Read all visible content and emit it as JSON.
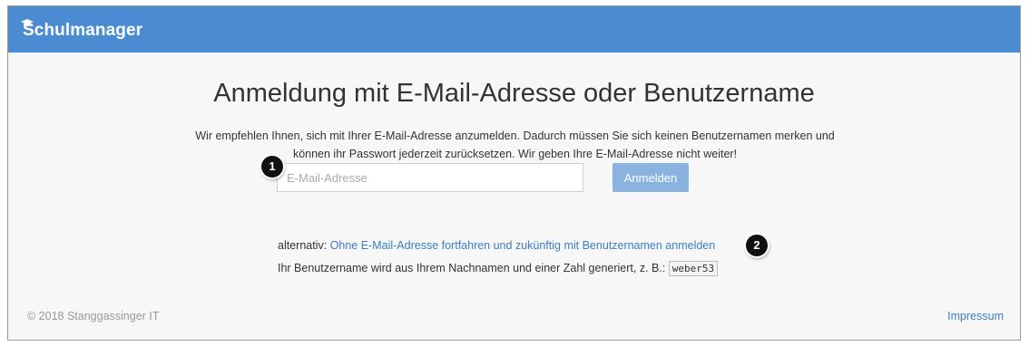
{
  "header": {
    "brand": "Schulmanager"
  },
  "main": {
    "title": "Anmeldung mit E-Mail-Adresse oder Benutzername",
    "intro": "Wir empfehlen Ihnen, sich mit Ihrer E-Mail-Adresse anzumelden. Dadurch müssen Sie sich keinen Benutzernamen merken und können ihr Passwort jederzeit zurücksetzen. Wir geben Ihre E-Mail-Adresse nicht weiter!",
    "email_placeholder": "E-Mail-Adresse",
    "login_label": "Anmelden",
    "alt_prefix": "alternativ: ",
    "alt_link": "Ohne E-Mail-Adresse fortfahren und zukünftig mit Benutzernamen anmelden",
    "hint": "Ihr Benutzername wird aus Ihrem Nachnamen und einer Zahl generiert, z. B.: ",
    "example_username": "weber53"
  },
  "annotations": {
    "badge1": "1",
    "badge2": "2"
  },
  "footer": {
    "copyright": "© 2018 Stanggassinger IT",
    "impressum": "Impressum"
  },
  "colors": {
    "header": "#4a8bd2",
    "link": "#3b7dc4",
    "button": "#8ab3e0"
  }
}
